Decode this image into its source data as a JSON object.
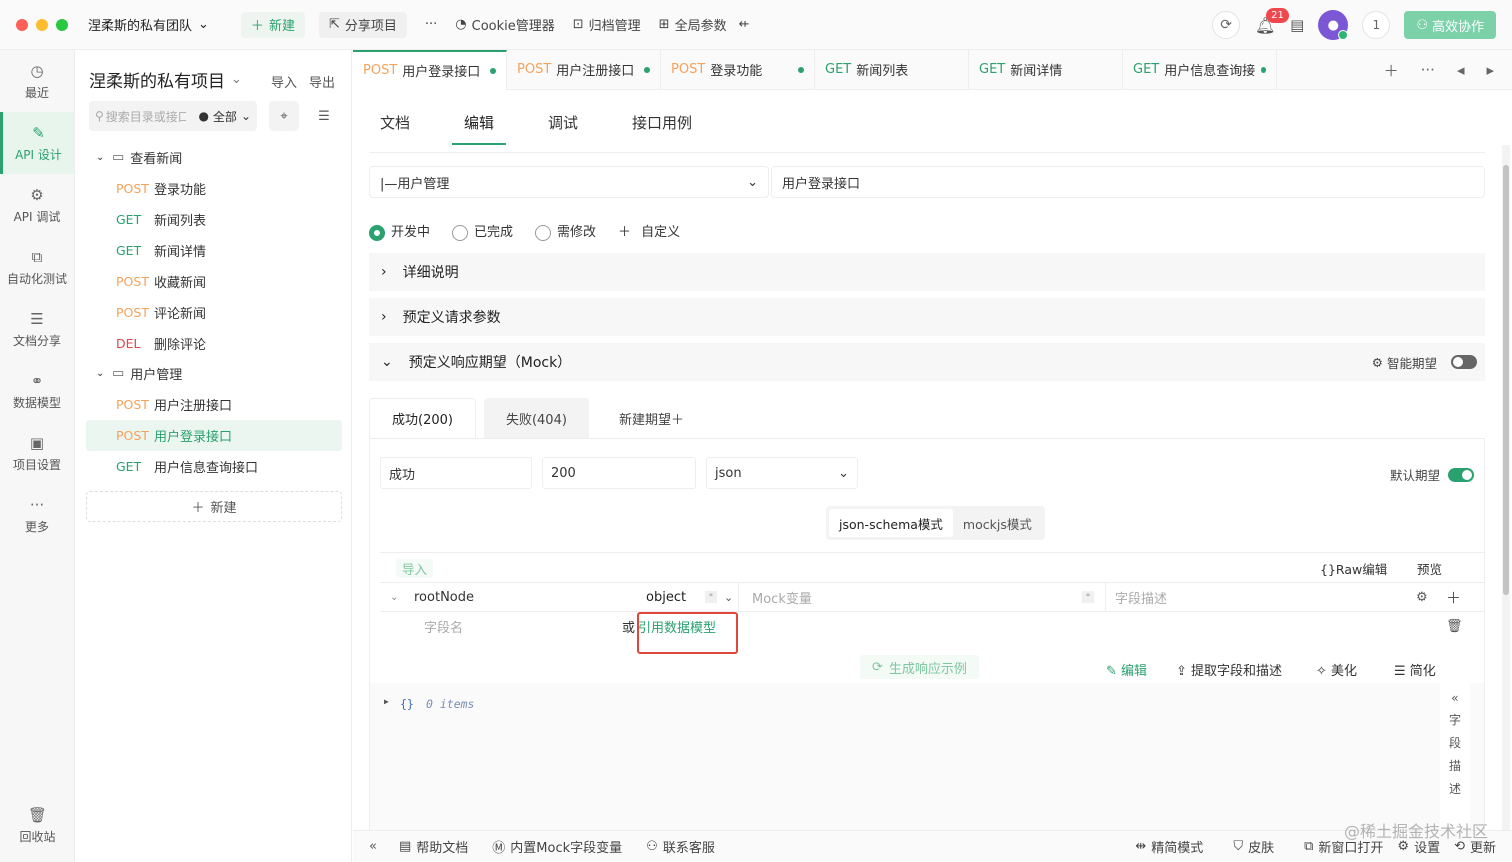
{
  "topbar": {
    "team": "涅柔斯的私有团队",
    "new": "新建",
    "share": "分享项目",
    "more": "···",
    "cookie": "Cookie管理器",
    "archive": "归档管理",
    "global": "全局参数",
    "notifications": "21",
    "count": "1",
    "collab": "高效协作"
  },
  "nav": {
    "items": [
      {
        "label": "最近",
        "icon": "clock-icon",
        "glyph": "◷"
      },
      {
        "label": "API 设计",
        "icon": "design-icon",
        "glyph": "✎"
      },
      {
        "label": "API 调试",
        "icon": "debug-icon",
        "glyph": "⚙"
      },
      {
        "label": "自动化测试",
        "icon": "test-icon",
        "glyph": "⧉"
      },
      {
        "label": "文档分享",
        "icon": "doc-icon",
        "glyph": "☰"
      },
      {
        "label": "数据模型",
        "icon": "model-icon",
        "glyph": "⚭"
      },
      {
        "label": "项目设置",
        "icon": "settings-icon",
        "glyph": "▣"
      },
      {
        "label": "更多",
        "icon": "more-icon",
        "glyph": "···"
      }
    ],
    "recycle": "回收站"
  },
  "tree": {
    "title": "涅柔斯的私有项目",
    "import": "导入",
    "export": "导出",
    "search_placeholder": "搜索目录或接口",
    "filter": "全部",
    "folder1": "查看新闻",
    "folder2": "用户管理",
    "items1": [
      {
        "method": "POST",
        "cls": "m-post",
        "label": "登录功能"
      },
      {
        "method": "GET",
        "cls": "m-get",
        "label": "新闻列表"
      },
      {
        "method": "GET",
        "cls": "m-get",
        "label": "新闻详情"
      },
      {
        "method": "POST",
        "cls": "m-post",
        "label": "收藏新闻"
      },
      {
        "method": "POST",
        "cls": "m-post",
        "label": "评论新闻"
      },
      {
        "method": "DEL",
        "cls": "m-del",
        "label": "删除评论"
      }
    ],
    "items2": [
      {
        "method": "POST",
        "cls": "m-post",
        "label": "用户注册接口"
      },
      {
        "method": "POST",
        "cls": "m-post",
        "label": "用户登录接口"
      },
      {
        "method": "GET",
        "cls": "m-get",
        "label": "用户信息查询接口"
      }
    ],
    "new": "新建"
  },
  "tabs": [
    {
      "method": "POST",
      "cls": "m-post",
      "label": "用户登录接口",
      "dot": true
    },
    {
      "method": "POST",
      "cls": "m-post",
      "label": "用户注册接口",
      "dot": true
    },
    {
      "method": "POST",
      "cls": "m-post",
      "label": "登录功能",
      "dot": true
    },
    {
      "method": "GET",
      "cls": "m-get",
      "label": "新闻列表",
      "dot": false
    },
    {
      "method": "GET",
      "cls": "m-get",
      "label": "新闻详情",
      "dot": false
    },
    {
      "method": "GET",
      "cls": "m-get",
      "label": "用户信息查询接口",
      "dot": true
    }
  ],
  "subtabs": [
    "文档",
    "编辑",
    "调试",
    "接口用例"
  ],
  "form": {
    "folder": "|—用户管理",
    "name": "用户登录接口",
    "status": [
      "开发中",
      "已完成",
      "需修改"
    ],
    "custom": "自定义",
    "section1": "详细说明",
    "section2": "预定义请求参数",
    "section3": "预定义响应期望（Mock）",
    "smart": "智能期望"
  },
  "expect": {
    "tabs": [
      "成功(200)",
      "失败(404)"
    ],
    "new": "新建期望",
    "name": "成功",
    "code": "200",
    "type": "json",
    "default": "默认期望",
    "mode1": "json-schema模式",
    "mode2": "mockjs模式",
    "import": "导入",
    "raw": "{}Raw编辑",
    "preview": "预览",
    "root": "rootNode",
    "rootType": "object",
    "mockVar": "Mock变量",
    "fieldDesc": "字段描述",
    "fieldName": "字段名",
    "or": "或",
    "ref": "引用数据模型",
    "generate": "生成响应示例",
    "edit": "编辑",
    "extract": "提取字段和描述",
    "beautify": "美化",
    "simplify": "简化",
    "code_text": "{}",
    "code_items": "0 items",
    "side": [
      "字",
      "段",
      "描",
      "述"
    ]
  },
  "bottom": {
    "help": "帮助文档",
    "mock": "内置Mock字段变量",
    "service": "联系客服",
    "compact": "精简模式",
    "skin": "皮肤",
    "window": "新窗口打开",
    "settings": "设置",
    "update": "更新"
  },
  "watermark": "@稀土掘金技术社区"
}
